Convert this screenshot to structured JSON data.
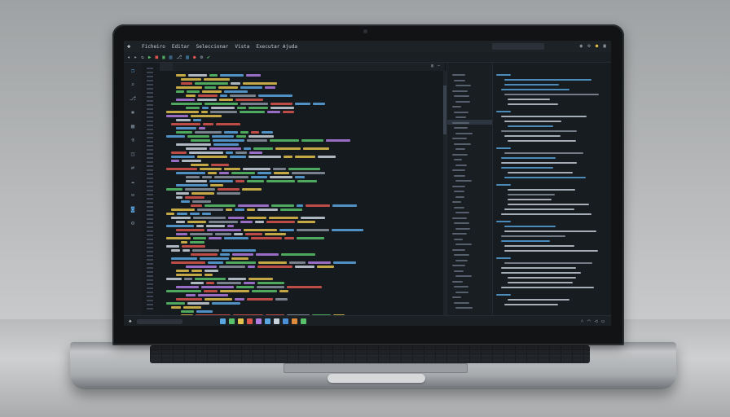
{
  "window": {
    "menu": [
      "Ficheiro",
      "Editar",
      "Seleccionar",
      "Vista",
      "Executar Ajuda"
    ],
    "icons": [
      "app-logo-icon",
      "search-box",
      "account-icon",
      "settings-icon",
      "theme-icon"
    ]
  },
  "toolbar": {
    "icons": [
      "back-icon",
      "forward-icon",
      "refresh-icon",
      "run-icon",
      "stop-icon",
      "debug-icon",
      "build-icon",
      "branch-icon",
      "split-icon",
      "settings-icon"
    ]
  },
  "activity_bar": {
    "icons": [
      "files-icon",
      "search-icon",
      "git-icon",
      "debug-icon",
      "extensions-icon",
      "test-icon",
      "docker-icon",
      "remote-icon",
      "cloud-icon",
      "terminal-icon",
      "database-icon",
      "settings-icon"
    ]
  },
  "editor": {
    "tab_label": "",
    "colors": {
      "keyword": "#d9564c",
      "string": "#e3c24e",
      "function": "#5aa6e0",
      "variable": "#c9d3dd",
      "comment": "#8a94a0",
      "number": "#b07de0",
      "type": "#58c26a"
    }
  },
  "explorer": {
    "header": ""
  },
  "panel": {
    "header": ""
  },
  "statusbar": {
    "app_colors": [
      "#5aa6e0",
      "#58c26a",
      "#e3c24e",
      "#d9564c",
      "#b07de0",
      "#5aa6e0",
      "#c9d3dd",
      "#4a8fd8",
      "#e08a3c",
      "#58c26a"
    ]
  }
}
